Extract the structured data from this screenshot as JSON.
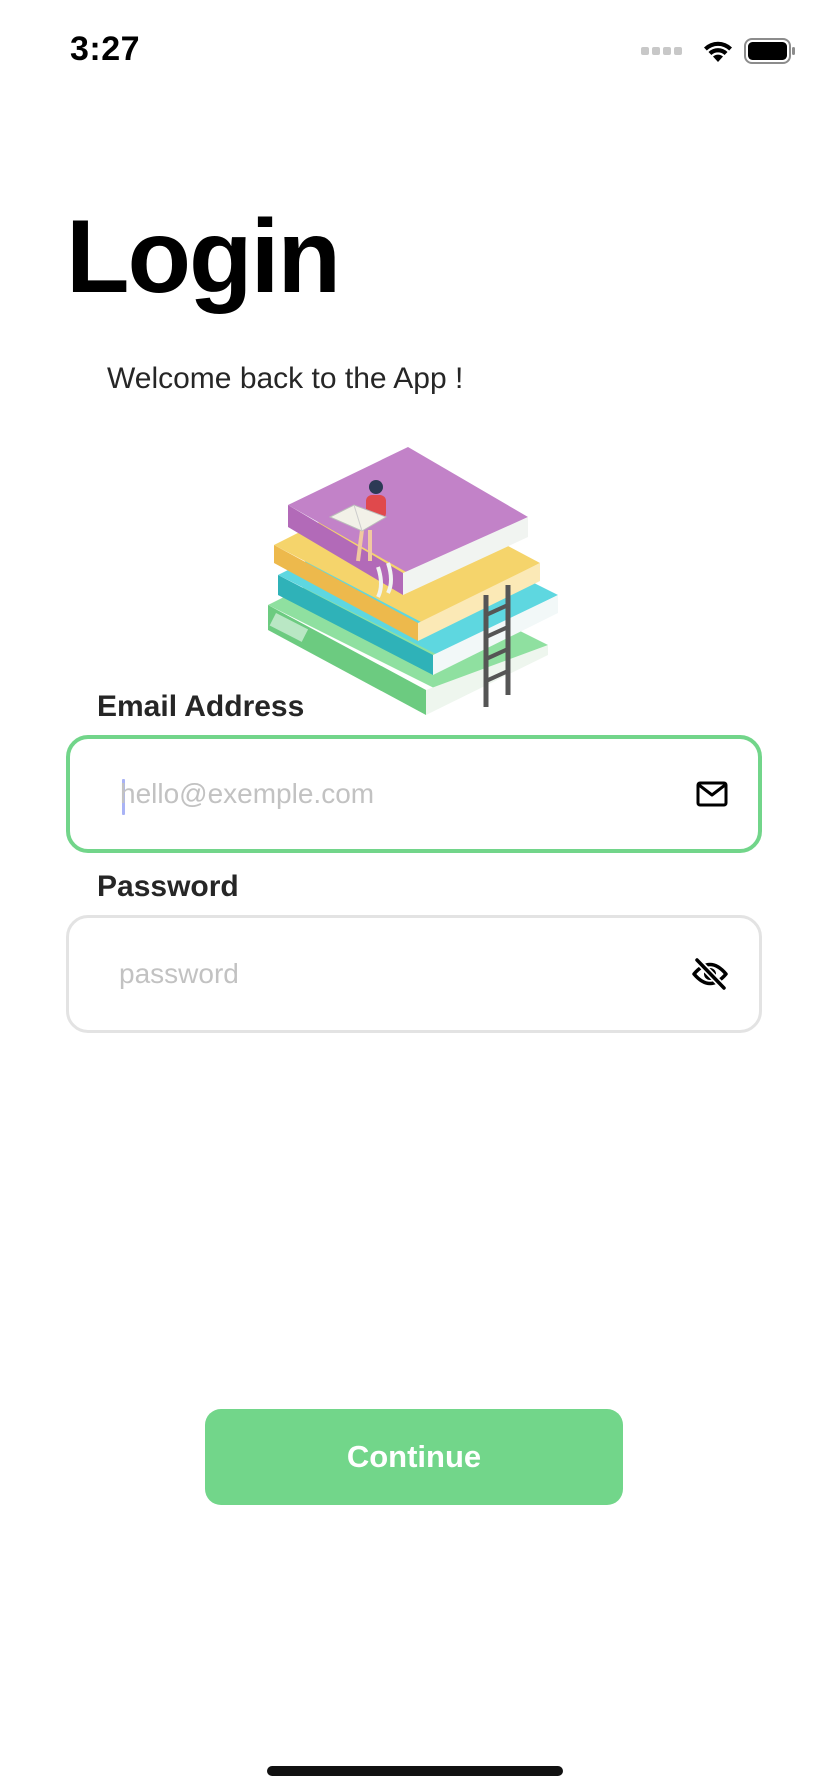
{
  "status_bar": {
    "time": "3:27",
    "icons": [
      "signal-dots-icon",
      "wifi-icon",
      "battery-icon"
    ]
  },
  "login": {
    "title": "Login",
    "subtitle": "Welcome back to the App !",
    "illustration": "stack-of-books-illustration"
  },
  "email": {
    "label": "Email Address",
    "value": "",
    "placeholder": "hello@exemple.com",
    "icon": "mail-icon",
    "focused": true
  },
  "password": {
    "label": "Password",
    "value": "",
    "placeholder": "password",
    "icon": "eye-off-icon"
  },
  "actions": {
    "continue_label": "Continue"
  },
  "colors": {
    "accent": "#72d68a",
    "field_border": "#e3e3e3",
    "placeholder": "#c2c2c2",
    "text": "#262626"
  }
}
